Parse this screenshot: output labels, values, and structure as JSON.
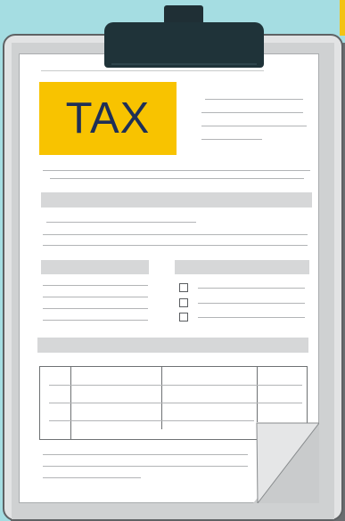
{
  "badge": {
    "label": "TAX",
    "background": "#f8c300",
    "text_color": "#1e2f57"
  },
  "colors": {
    "background": "#a5dde2",
    "clipboard_board": "#e2e3e4",
    "clip": "#1f3339",
    "paper": "#ffffff",
    "accent": "#f3c315"
  },
  "form": {
    "checkboxes": [
      false,
      false,
      false
    ]
  }
}
